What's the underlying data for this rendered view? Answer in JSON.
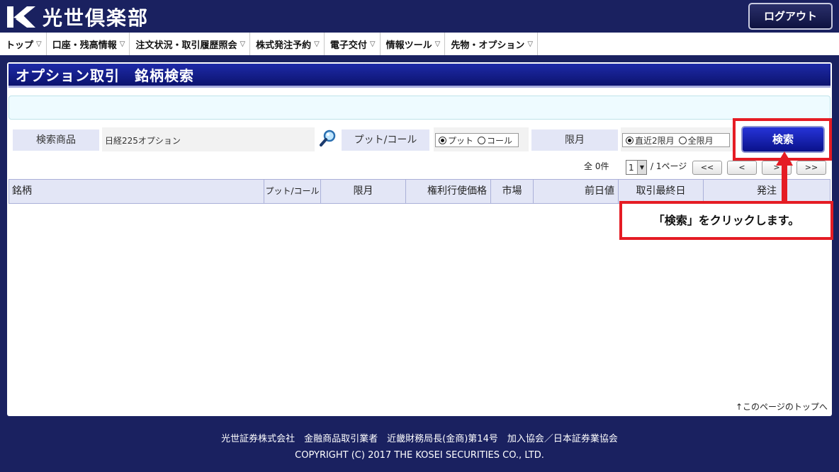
{
  "header": {
    "brand": "光世倶楽部",
    "logout_label": "ログアウト"
  },
  "nav": {
    "items": [
      {
        "label": "トップ"
      },
      {
        "label": "口座・残高情報"
      },
      {
        "label": "注文状況・取引履歴照会"
      },
      {
        "label": "株式発注予約"
      },
      {
        "label": "電子交付"
      },
      {
        "label": "情報ツール"
      },
      {
        "label": "先物・オプション"
      }
    ],
    "dropdown_glyph": "▽"
  },
  "page": {
    "title": "オプション取引　銘柄検索"
  },
  "search_form": {
    "product_label": "検索商品",
    "product_value": "日経225オプション",
    "putcall_label": "プット/コール",
    "putcall_options": [
      {
        "label": "プット",
        "selected": true
      },
      {
        "label": "コール",
        "selected": false
      }
    ],
    "month_label": "限月",
    "month_options": [
      {
        "label": "直近2限月",
        "selected": true
      },
      {
        "label": "全限月",
        "selected": false
      }
    ],
    "search_button": "検索"
  },
  "pagination": {
    "total_text": "全 0件",
    "current_page": "1",
    "pages_text": "/ 1ページ",
    "first": "<<",
    "prev": "<",
    "next": ">",
    "last": ">>"
  },
  "table": {
    "columns": [
      "銘柄",
      "プット/コール",
      "限月",
      "権利行使価格",
      "市場",
      "前日値",
      "取引最終日",
      "発注"
    ]
  },
  "annotation": {
    "callout_text": "「検索」をクリックします。"
  },
  "back_to_top": "↑このページのトップへ",
  "footer": {
    "line1": "光世証券株式会社　金融商品取引業者　近畿財務局長(金商)第14号　加入協会／日本証券業協会",
    "line2": "COPYRIGHT (C) 2017 THE KOSEI SECURITIES CO., LTD."
  },
  "colors": {
    "accent": "#0c136e",
    "highlight": "#e51c24",
    "label_bg": "#e3e6f6"
  }
}
